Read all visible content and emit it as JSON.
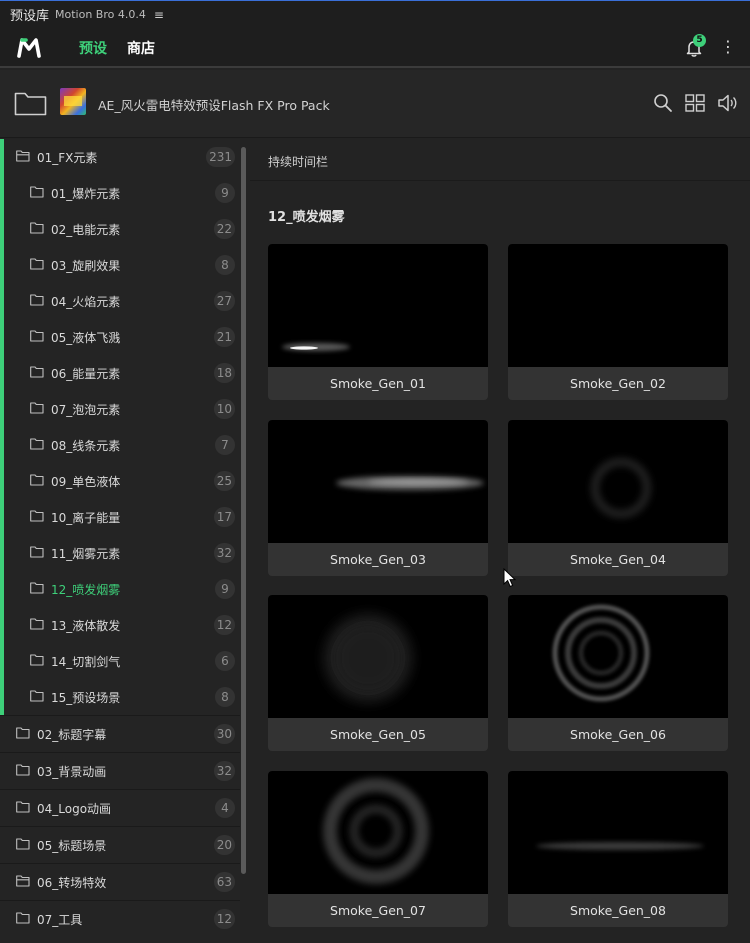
{
  "panel": {
    "name": "预设库",
    "version": "Motion Bro 4.0.4",
    "menu_glyph": "≡"
  },
  "nav": {
    "tabs": [
      "预设",
      "商店"
    ],
    "active_tab": "预设",
    "notification_count": "5",
    "more_glyph": "⋮"
  },
  "pack": {
    "title": "AE_风火雷电特效预设Flash FX Pro Pack"
  },
  "sidebar": {
    "groups": [
      {
        "label": "01_FX元素",
        "count": "231",
        "children": [
          {
            "label": "01_爆炸元素",
            "count": "9"
          },
          {
            "label": "02_电能元素",
            "count": "22"
          },
          {
            "label": "03_旋刷效果",
            "count": "8"
          },
          {
            "label": "04_火焰元素",
            "count": "27"
          },
          {
            "label": "05_液体飞溅",
            "count": "21"
          },
          {
            "label": "06_能量元素",
            "count": "18"
          },
          {
            "label": "07_泡泡元素",
            "count": "10"
          },
          {
            "label": "08_线条元素",
            "count": "7"
          },
          {
            "label": "09_单色液体",
            "count": "25"
          },
          {
            "label": "10_离子能量",
            "count": "17"
          },
          {
            "label": "11_烟雾元素",
            "count": "32"
          },
          {
            "label": "12_喷发烟雾",
            "count": "9"
          },
          {
            "label": "13_液体散发",
            "count": "12"
          },
          {
            "label": "14_切割剑气",
            "count": "6"
          },
          {
            "label": "15_预设场景",
            "count": "8"
          }
        ]
      },
      {
        "label": "02_标题字幕",
        "count": "30"
      },
      {
        "label": "03_背景动画",
        "count": "32"
      },
      {
        "label": "04_Logo动画",
        "count": "4"
      },
      {
        "label": "05_标题场景",
        "count": "20"
      },
      {
        "label": "06_转场特效",
        "count": "63"
      },
      {
        "label": "07_工具",
        "count": "12"
      }
    ],
    "active_item": "12_喷发烟雾"
  },
  "main": {
    "duration_label": "持续时间栏",
    "section_title": "12_喷发烟雾",
    "presets": [
      "Smoke_Gen_01",
      "Smoke_Gen_02",
      "Smoke_Gen_03",
      "Smoke_Gen_04",
      "Smoke_Gen_05",
      "Smoke_Gen_06",
      "Smoke_Gen_07",
      "Smoke_Gen_08"
    ]
  },
  "colors": {
    "accent": "#3ed07a",
    "background": "#232323",
    "card": "#333333"
  }
}
